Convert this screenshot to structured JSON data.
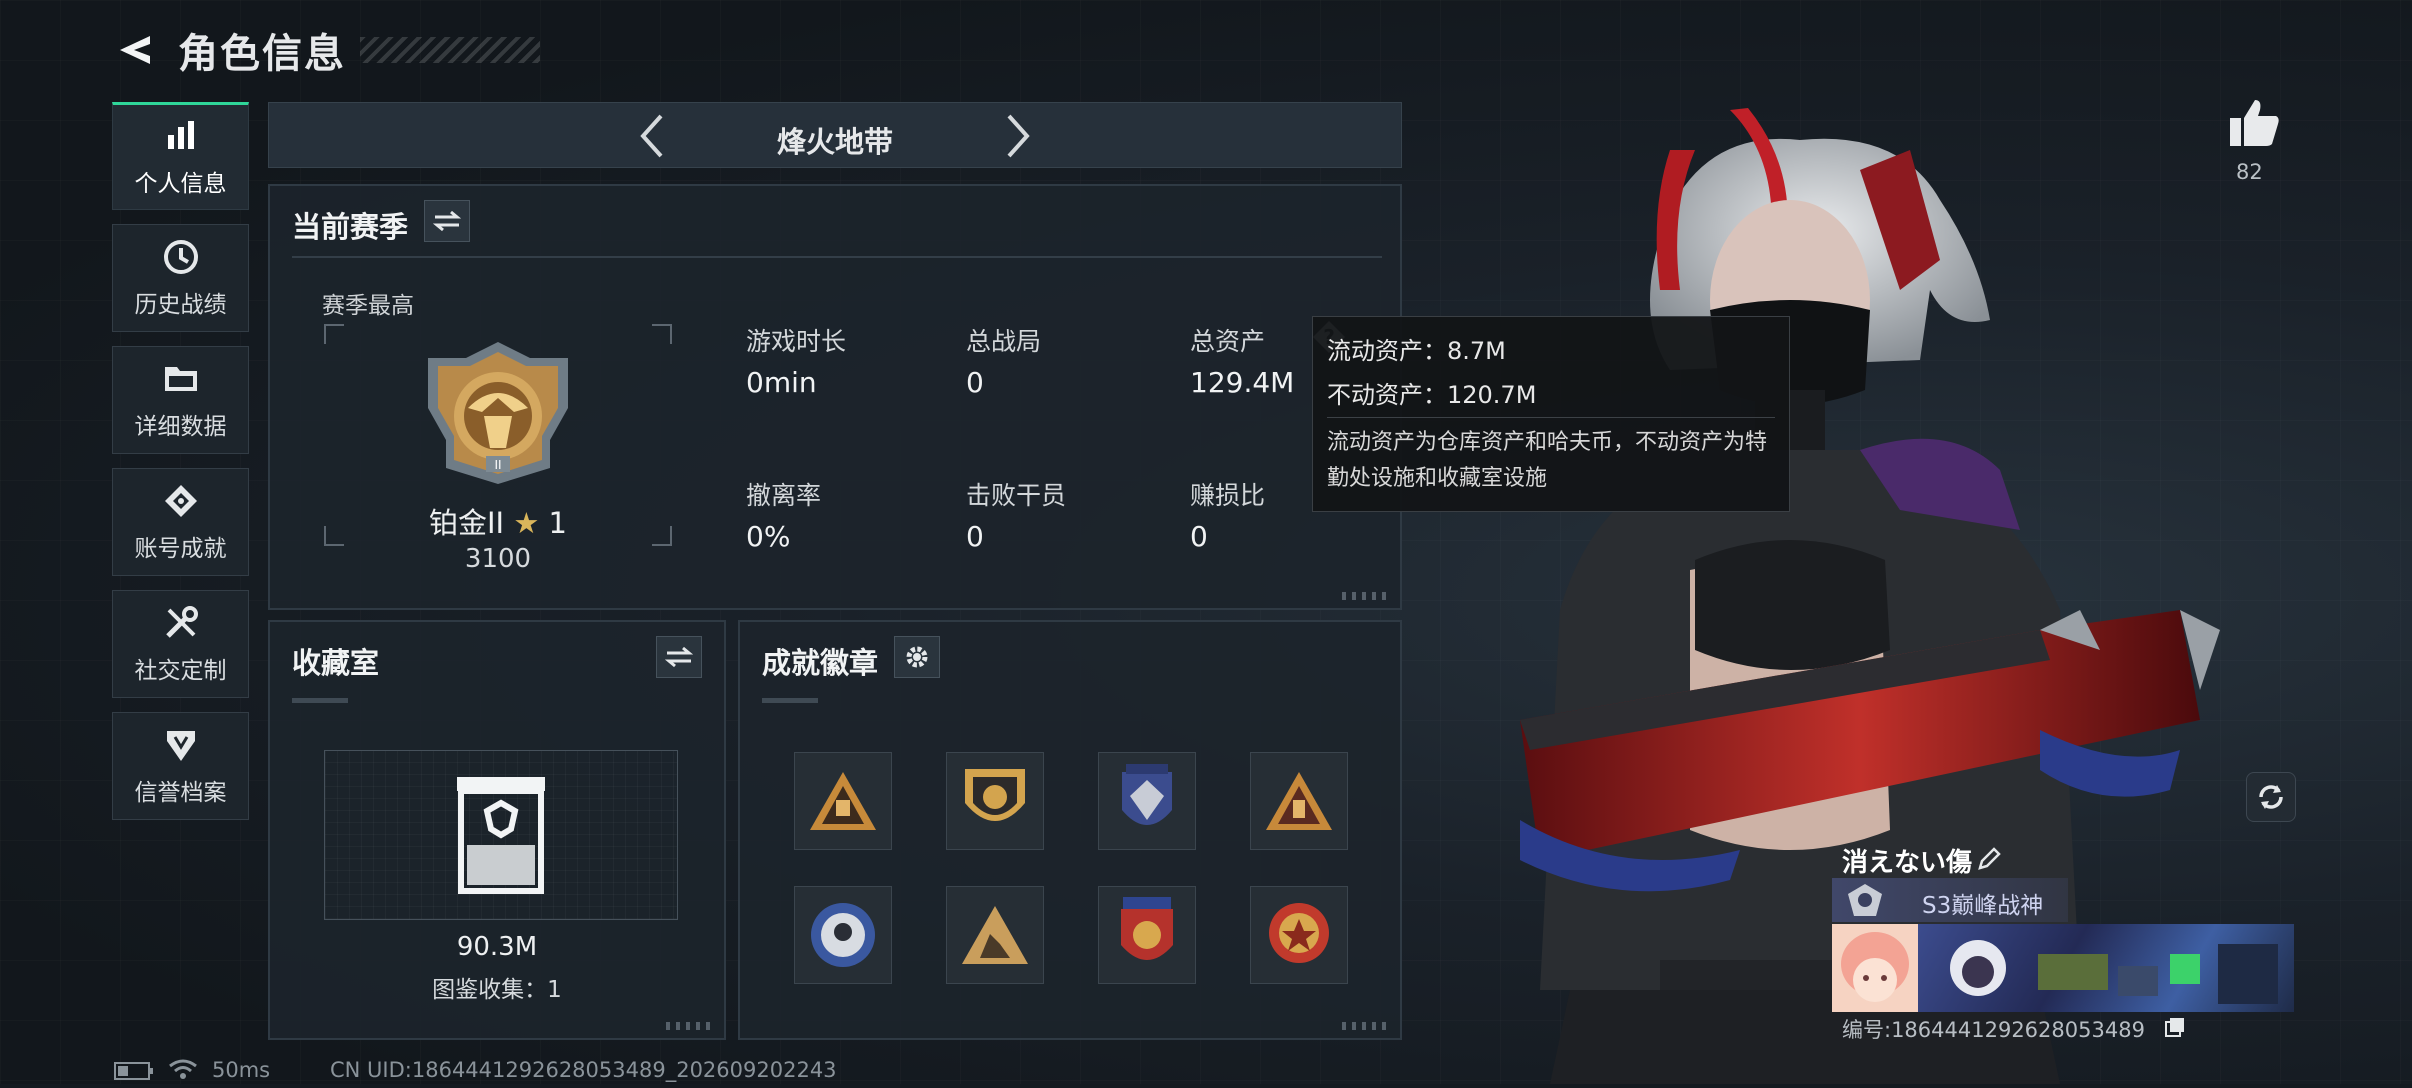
{
  "header": {
    "title": "角色信息"
  },
  "sidebar": {
    "items": [
      {
        "label": "个人信息",
        "icon": "bar-chart-icon",
        "active": true
      },
      {
        "label": "历史战绩",
        "icon": "clock-icon",
        "active": false
      },
      {
        "label": "详细数据",
        "icon": "folder-icon",
        "active": false
      },
      {
        "label": "账号成就",
        "icon": "achievement-icon",
        "active": false
      },
      {
        "label": "社交定制",
        "icon": "tools-icon",
        "active": false
      },
      {
        "label": "信誉档案",
        "icon": "shield-icon",
        "active": false
      }
    ]
  },
  "mode_selector": {
    "title": "烽火地带"
  },
  "season": {
    "title": "当前赛季",
    "highest_label": "赛季最高",
    "rank": "铂金II",
    "stars": "1",
    "score": "3100",
    "stats": [
      {
        "label": "游戏时长",
        "value": "0min"
      },
      {
        "label": "总战局",
        "value": "0"
      },
      {
        "label": "总资产",
        "value": "129.4M"
      },
      {
        "label": "撤离率",
        "value": "0%"
      },
      {
        "label": "击败干员",
        "value": "0"
      },
      {
        "label": "赚损比",
        "value": "0"
      }
    ]
  },
  "tooltip": {
    "line1": "流动资产：8.7M",
    "line2": "不动资产：120.7M",
    "desc": "流动资产为仓库资产和哈夫币，不动资产为特勤处设施和收藏室设施"
  },
  "collection": {
    "title": "收藏室",
    "value": "90.3M",
    "catalog": "图鉴收集：1"
  },
  "badges": {
    "title": "成就徽章",
    "items": [
      "triangle-badge-icon",
      "shield-badge-icon",
      "crest-badge-icon",
      "triangle-badge-icon",
      "round-badge-icon",
      "triangle-badge-icon",
      "crest-badge-icon",
      "round-badge-icon"
    ]
  },
  "likes": {
    "count": "82"
  },
  "player": {
    "name": "消えない傷",
    "title": "S3巅峰战神",
    "id": "编号:1864441292628053489"
  },
  "status_bar": {
    "ping": "50ms",
    "uid": "CN UID:1864441292628053489_202609202243"
  },
  "colors": {
    "accent": "#2fd699",
    "panel": "#1c242b"
  }
}
